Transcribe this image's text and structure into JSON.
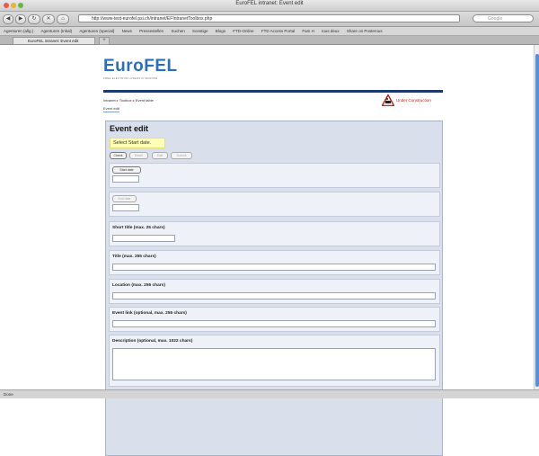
{
  "window": {
    "title": "EuroFEL intranet: Event edit",
    "url": "http://www-test-eurofel.psi.ch/intranet/EFIntranetToolbox.php",
    "search_placeholder": "Google"
  },
  "bookmarks": [
    "Agenturen (allg.)",
    "Agenturen (Inkal)",
    "Agenturen (special)",
    "News",
    "Pressestellen",
    "Suchen",
    "Sonstige",
    "Blogs",
    "FTD-Online",
    "FTD Access Portal",
    "Fam H",
    "tous deux",
    "Share on Posterous"
  ],
  "tab": {
    "title": "EuroFEL intranet: Event edit"
  },
  "status": {
    "text": "Done"
  },
  "logo": {
    "text": "EuroFEL",
    "subtitle": "FREE ELECTRON LASERS IN EUROPE"
  },
  "breadcrumb": {
    "home": "Intranet",
    "level1": "Toolbox",
    "level2": "Event table",
    "separator": "▸",
    "current": "Event edit"
  },
  "construction": {
    "label": "Under Construction"
  },
  "form": {
    "title": "Event edit",
    "notice": "Select Start date.",
    "buttons": {
      "check": "Check",
      "reset": "Reset",
      "edit": "Edit",
      "submit": "Submit"
    },
    "start_date": "Start date",
    "end_date": "End date",
    "short_title": "Short title (max. 25 chars)",
    "title_label": "Title (max. 255 chars)",
    "location": "Location (max. 255 chars)",
    "event_link": "Event link (optional, max. 255 chars)",
    "description": "Description (optional, max. 1022 chars)"
  }
}
